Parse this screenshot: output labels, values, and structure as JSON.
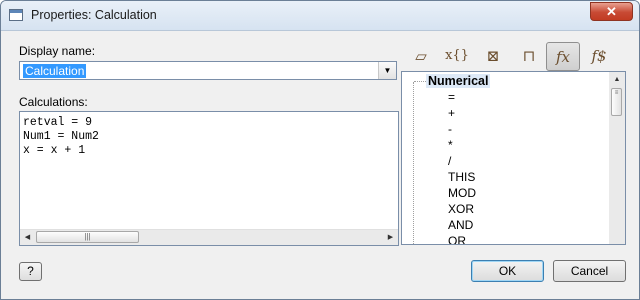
{
  "window": {
    "title": "Properties: Calculation",
    "close_label": "✕"
  },
  "display_name": {
    "label": "Display name:",
    "value": "Calculation",
    "dropdown_arrow": "▼"
  },
  "calculations": {
    "label": "Calculations:",
    "code": "retval = 9\nNum1 = Num2\nx = x + 1",
    "scroll_left": "◀",
    "scroll_right": "▶",
    "thumb_grip": "|||"
  },
  "toolbar": {
    "buttons": [
      {
        "icon": "parallelogram-icon",
        "glyph": "▱"
      },
      {
        "icon": "variable-braces-icon",
        "glyph": "x{}"
      },
      {
        "icon": "variable-box-icon",
        "glyph": "⊠"
      },
      {
        "icon": "component-icon",
        "glyph": "⊓"
      },
      {
        "icon": "function-icon",
        "glyph": "fx",
        "active": true
      },
      {
        "icon": "string-function-icon",
        "glyph": "f$"
      }
    ]
  },
  "tree": {
    "root": "Numerical",
    "items": [
      "=",
      "+",
      "-",
      "*",
      "/",
      "THIS",
      "MOD",
      "XOR",
      "AND",
      "OR"
    ],
    "scroll_up": "▲",
    "thumb_grip": "≡"
  },
  "footer": {
    "help_label": "?",
    "ok_label": "OK",
    "cancel_label": "Cancel"
  }
}
